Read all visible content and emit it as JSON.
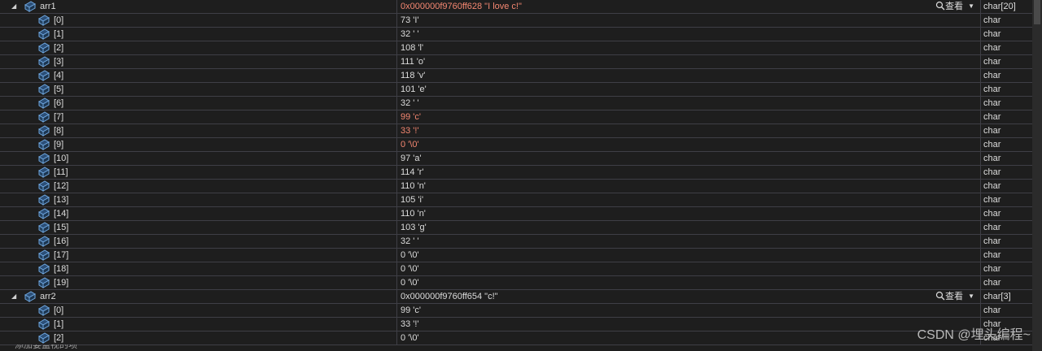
{
  "colors": {
    "changed": "#f48771",
    "text": "#dcdcdc",
    "background": "#1e1e1e",
    "grid": "#3f3f46",
    "icon": "#6ea6df"
  },
  "icons": {
    "expander": "collapse-triangle-icon",
    "variable": "object-cube-icon",
    "view": "magnifier-icon",
    "dropdown": "chevron-down-icon"
  },
  "variables": [
    {
      "name": "arr1",
      "value": "0x000000f9760ff628 \"I love c!\"",
      "type": "char[20]",
      "changed": true,
      "view_label": "查看",
      "children": [
        {
          "name": "[0]",
          "value": "73 'I'",
          "type": "char",
          "changed": false
        },
        {
          "name": "[1]",
          "value": "32 ' '",
          "type": "char",
          "changed": false
        },
        {
          "name": "[2]",
          "value": "108 'l'",
          "type": "char",
          "changed": false
        },
        {
          "name": "[3]",
          "value": "111 'o'",
          "type": "char",
          "changed": false
        },
        {
          "name": "[4]",
          "value": "118 'v'",
          "type": "char",
          "changed": false
        },
        {
          "name": "[5]",
          "value": "101 'e'",
          "type": "char",
          "changed": false
        },
        {
          "name": "[6]",
          "value": "32 ' '",
          "type": "char",
          "changed": false
        },
        {
          "name": "[7]",
          "value": "99 'c'",
          "type": "char",
          "changed": true
        },
        {
          "name": "[8]",
          "value": "33 '!'",
          "type": "char",
          "changed": true
        },
        {
          "name": "[9]",
          "value": "0 '\\0'",
          "type": "char",
          "changed": true
        },
        {
          "name": "[10]",
          "value": "97 'a'",
          "type": "char",
          "changed": false
        },
        {
          "name": "[11]",
          "value": "114 'r'",
          "type": "char",
          "changed": false
        },
        {
          "name": "[12]",
          "value": "110 'n'",
          "type": "char",
          "changed": false
        },
        {
          "name": "[13]",
          "value": "105 'i'",
          "type": "char",
          "changed": false
        },
        {
          "name": "[14]",
          "value": "110 'n'",
          "type": "char",
          "changed": false
        },
        {
          "name": "[15]",
          "value": "103 'g'",
          "type": "char",
          "changed": false
        },
        {
          "name": "[16]",
          "value": "32 ' '",
          "type": "char",
          "changed": false
        },
        {
          "name": "[17]",
          "value": "0 '\\0'",
          "type": "char",
          "changed": false
        },
        {
          "name": "[18]",
          "value": "0 '\\0'",
          "type": "char",
          "changed": false
        },
        {
          "name": "[19]",
          "value": "0 '\\0'",
          "type": "char",
          "changed": false
        }
      ]
    },
    {
      "name": "arr2",
      "value": "0x000000f9760ff654 \"c!\"",
      "type": "char[3]",
      "changed": false,
      "view_label": "查看",
      "children": [
        {
          "name": "[0]",
          "value": "99 'c'",
          "type": "char",
          "changed": false
        },
        {
          "name": "[1]",
          "value": "33 '!'",
          "type": "char",
          "changed": false
        },
        {
          "name": "[2]",
          "value": "0 '\\0'",
          "type": "char",
          "changed": false
        }
      ]
    }
  ],
  "add_watch_placeholder": "添加要监视的项",
  "watermark": "CSDN @埋头编程~"
}
